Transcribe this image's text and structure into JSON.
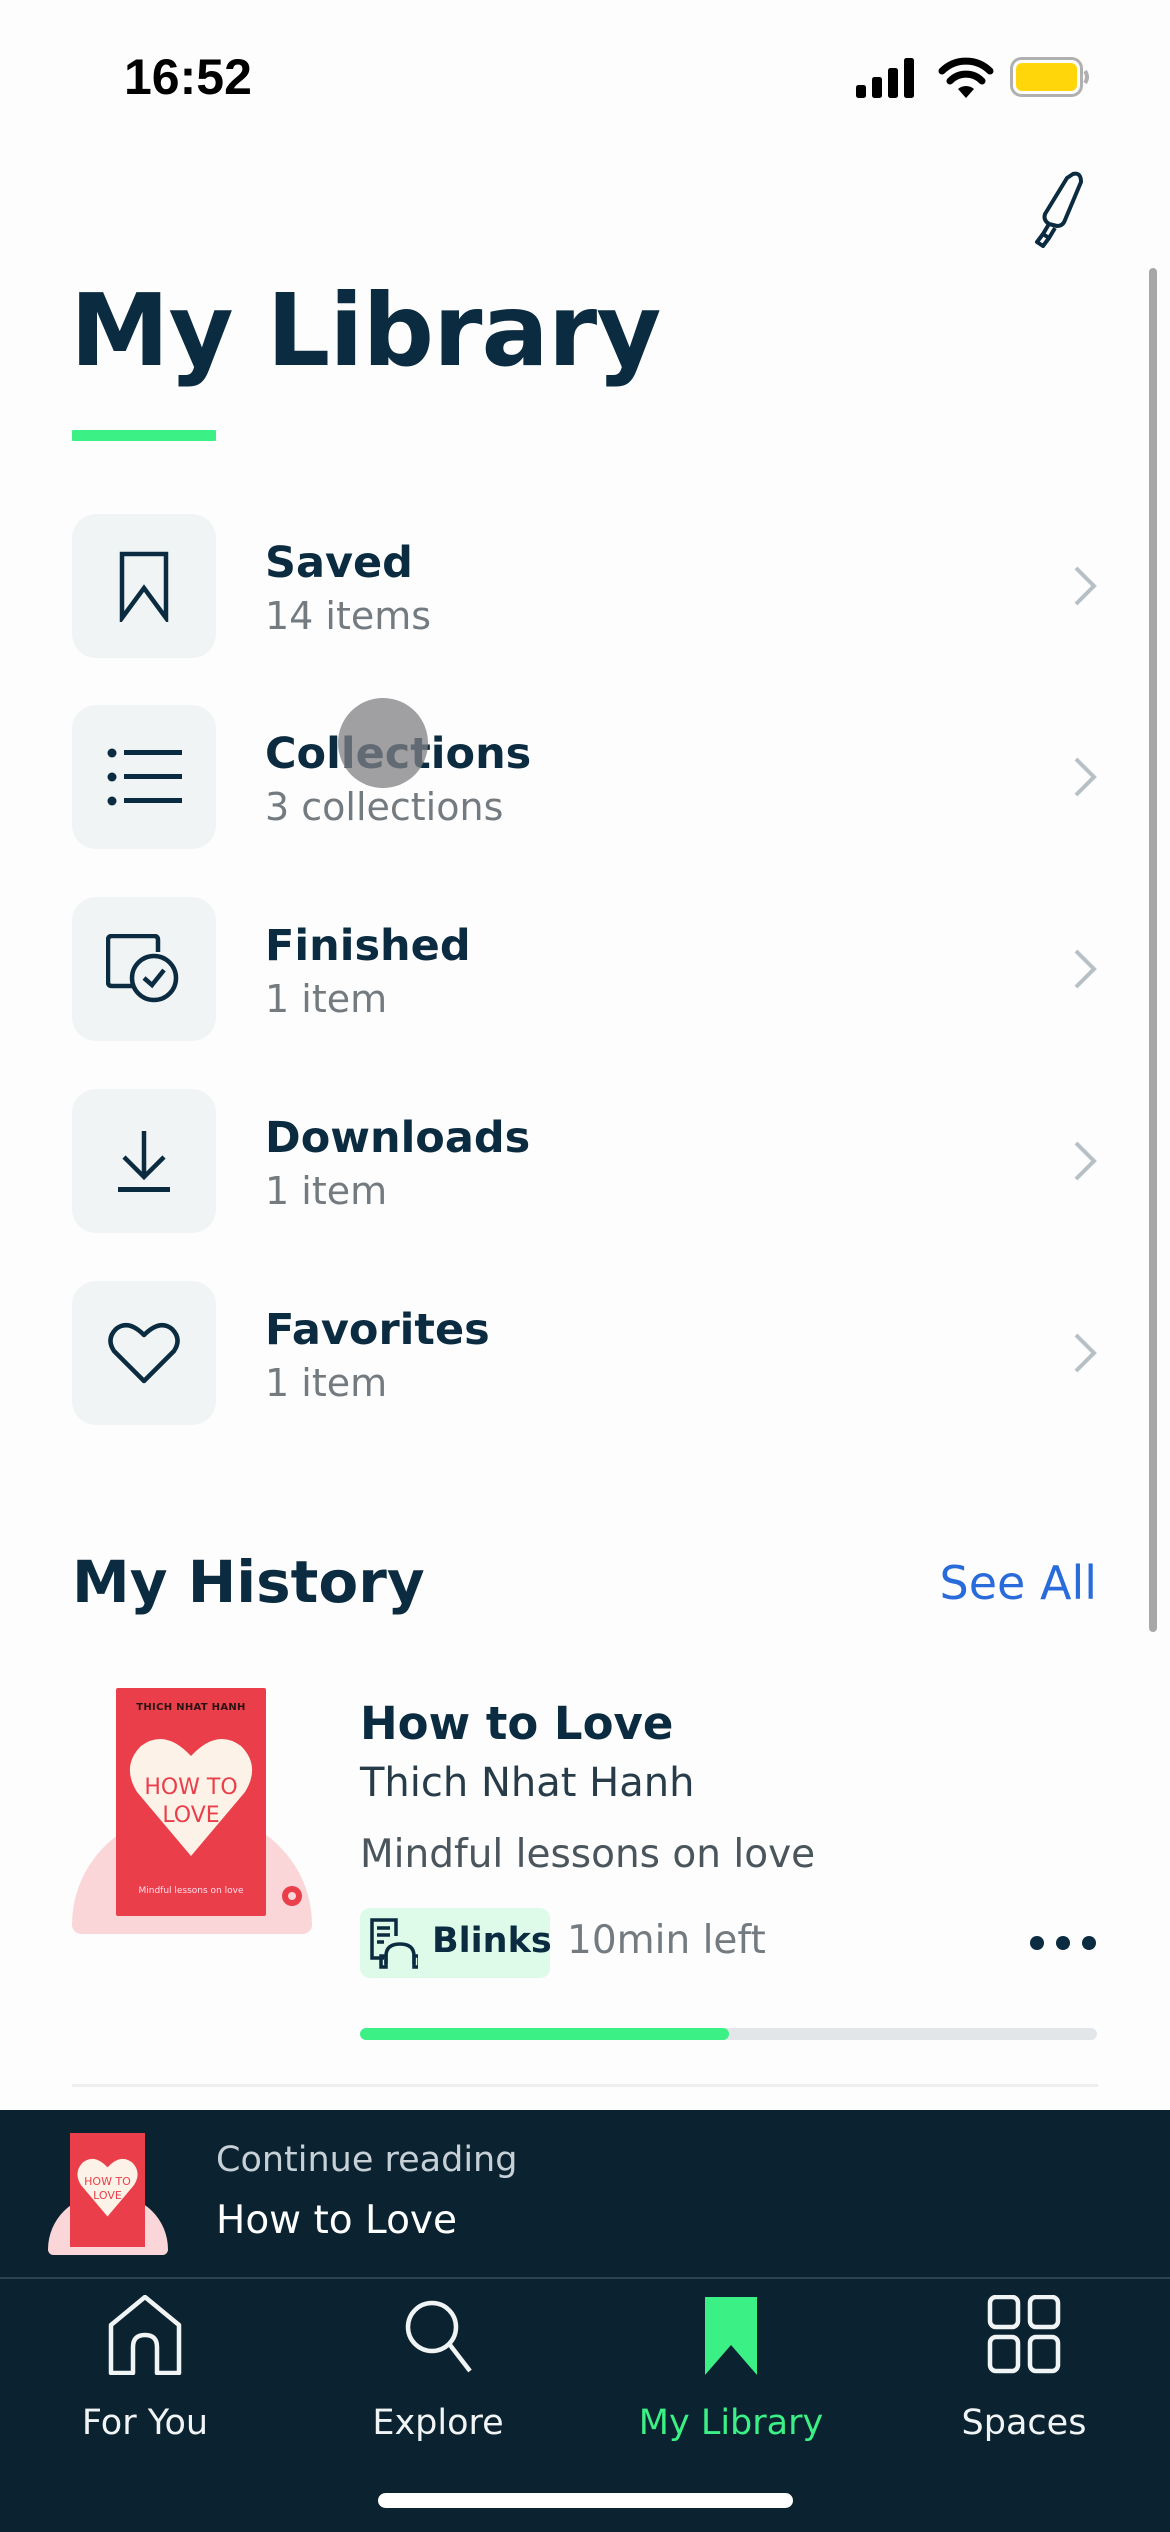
{
  "status_bar": {
    "time": "16:52",
    "signal_icon": "cellular-signal-icon",
    "wifi_icon": "wifi-icon",
    "battery_icon": "battery-icon",
    "battery_color": "#ffd60a"
  },
  "header": {
    "title": "My Library",
    "action_icon": "highlighter-icon",
    "accent_color": "#3bf085"
  },
  "library": {
    "items": [
      {
        "label": "Saved",
        "subtitle": "14 items",
        "icon": "bookmark-icon"
      },
      {
        "label": "Collections",
        "subtitle": "3 collections",
        "icon": "list-icon"
      },
      {
        "label": "Finished",
        "subtitle": "1 item",
        "icon": "finished-check-icon"
      },
      {
        "label": "Downloads",
        "subtitle": "1 item",
        "icon": "download-icon"
      },
      {
        "label": "Favorites",
        "subtitle": "1 item",
        "icon": "heart-icon"
      }
    ]
  },
  "history": {
    "title": "My History",
    "see_all": "See All",
    "items": [
      {
        "title": "How to Love",
        "author": "Thich Nhat Hanh",
        "description": "Mindful lessons on love",
        "badge": "Blinks",
        "time_left": "10min left",
        "progress": 0.5,
        "cover": {
          "author": "THICH NHAT HANH",
          "title_line1": "HOW TO",
          "title_line2": "LOVE",
          "subtitle": "Mindful lessons on love",
          "color": "#ea3f4a"
        }
      }
    ]
  },
  "continue_reading": {
    "label": "Continue reading",
    "title": "How to Love",
    "cover_title_line1": "HOW TO",
    "cover_title_line2": "LOVE"
  },
  "bottom_nav": {
    "items": [
      {
        "label": "For You",
        "icon": "home-icon",
        "active": false
      },
      {
        "label": "Explore",
        "icon": "search-icon",
        "active": false
      },
      {
        "label": "My Library",
        "icon": "bookmark-filled-icon",
        "active": true
      },
      {
        "label": "Spaces",
        "icon": "spaces-grid-icon",
        "active": false
      }
    ],
    "active_color": "#3bf085"
  }
}
